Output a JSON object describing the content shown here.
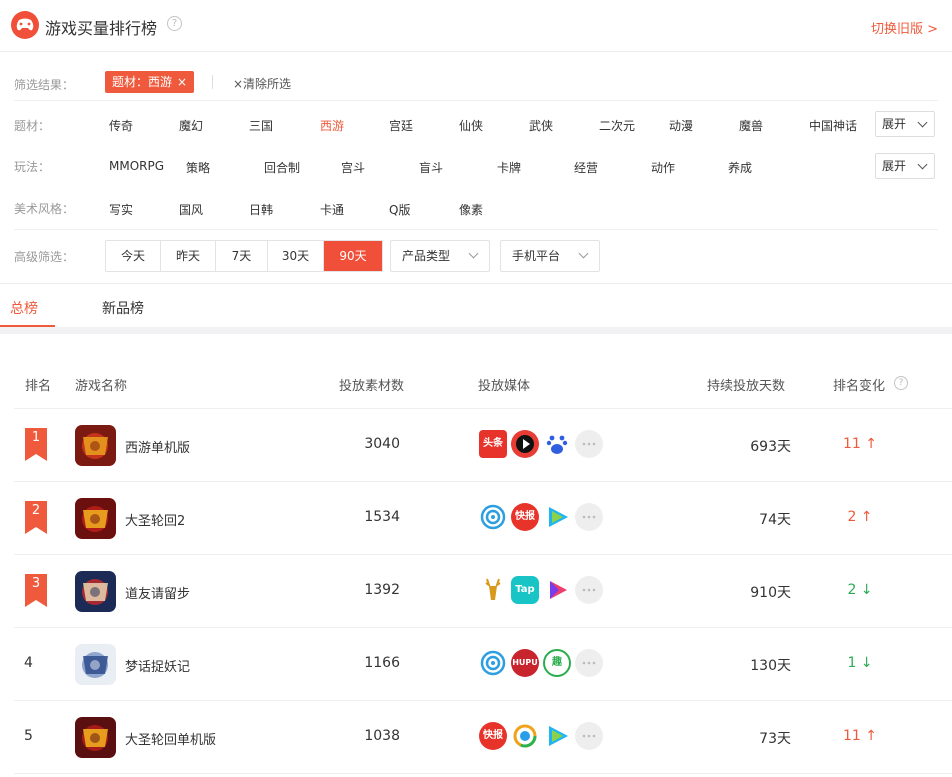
{
  "header": {
    "title": "游戏买量排行榜",
    "help": "?",
    "switch_label": "切换旧版 >"
  },
  "filters": {
    "result_label": "筛选结果：",
    "selected_tag": "题材：西游",
    "tag_close": "×",
    "clear_label": "×清除所选",
    "theme": {
      "label": "题材：",
      "options": [
        "传奇",
        "魔幻",
        "三国",
        "西游",
        "宫廷",
        "仙侠",
        "武侠",
        "二次元",
        "动漫",
        "魔兽",
        "中国神话"
      ],
      "active_index": 3,
      "expand_label": "展开"
    },
    "gameplay": {
      "label": "玩法：",
      "options": [
        "MMORPG",
        "策略",
        "回合制",
        "宫斗",
        "盲斗",
        "卡牌",
        "经营",
        "动作",
        "养成"
      ],
      "expand_label": "展开"
    },
    "art": {
      "label": "美术风格：",
      "options": [
        "写实",
        "国风",
        "日韩",
        "卡通",
        "Q版",
        "像素"
      ]
    },
    "advanced": {
      "label": "高级筛选：",
      "periods": [
        "今天",
        "昨天",
        "7天",
        "30天",
        "90天"
      ],
      "active_index": 4,
      "product_type": "产品类型",
      "platform": "手机平台"
    }
  },
  "tabs": [
    "总榜",
    "新品榜"
  ],
  "active_tab": 0,
  "table": {
    "columns": [
      "排名",
      "游戏名称",
      "投放素材数",
      "投放媒体",
      "持续投放天数",
      "排名变化"
    ],
    "rows": [
      {
        "rank": "1",
        "name": "西游单机版",
        "count": "3040",
        "media": [
          "toutiao-icon",
          "douyin-icon",
          "baidu-icon"
        ],
        "days": "693天",
        "change": "11 ↑",
        "dir": "up"
      },
      {
        "rank": "2",
        "name": "大圣轮回2",
        "count": "1534",
        "media": [
          "orbit-icon",
          "kuaikan-icon",
          "tencent-video-icon"
        ],
        "days": "74天",
        "change": "2 ↑",
        "dir": "up"
      },
      {
        "rank": "3",
        "name": "道友请留步",
        "count": "1392",
        "media": [
          "deer-icon",
          "taptap-icon",
          "play-icon"
        ],
        "days": "910天",
        "change": "2 ↓",
        "dir": "down"
      },
      {
        "rank": "4",
        "name": "梦话捉妖记",
        "count": "1166",
        "media": [
          "orbit-icon",
          "hupu-icon",
          "qu-icon"
        ],
        "days": "130天",
        "change": "1 ↓",
        "dir": "down"
      },
      {
        "rank": "5",
        "name": "大圣轮回单机版",
        "count": "1038",
        "media": [
          "kuaikan-icon",
          "vshare-icon",
          "tencent-video-icon"
        ],
        "days": "73天",
        "change": "11 ↑",
        "dir": "up"
      }
    ]
  },
  "media_text": {
    "toutiao-icon": "头条",
    "kuaikan-icon": "快报",
    "taptap-icon": "Tap",
    "hupu-icon": "HUPU",
    "qu-icon": "趣",
    "baidu-icon": "du"
  },
  "colors": {
    "accent": "#ef5a3c",
    "up": "#ef5a3c",
    "down": "#2dab55"
  }
}
